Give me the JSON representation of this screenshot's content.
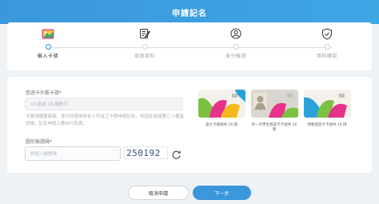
{
  "header": {
    "title": "申請記名"
  },
  "steps": [
    {
      "label": "輸入卡號",
      "icon": "card-icon",
      "active": true
    },
    {
      "label": "填寫資料",
      "icon": "form-edit-icon",
      "active": false
    },
    {
      "label": "身分驗證",
      "icon": "person-verify-icon",
      "active": false
    },
    {
      "label": "資料確認",
      "icon": "shield-check-icon",
      "active": false
    }
  ],
  "form": {
    "card_number": {
      "label": "悠遊卡外觀卡號*",
      "placeholder": "10 碼或 16 碼數字",
      "hint": "卡號須權實填寫，並切勿使用非本人所有之卡號申請記名，如因此造成第三人權益受損，記名申請人應自行負責。"
    },
    "captcha": {
      "label": "圖形驗證碼*",
      "placeholder": "請輸入驗證碼",
      "code": "250192"
    }
  },
  "cards": [
    {
      "caption": "晶片卡號碼共 16 碼"
    },
    {
      "caption": "新一代學生悠遊卡卡號共 16 碼"
    },
    {
      "caption": "特製悠遊卡卡號共 16 碼"
    }
  ],
  "buttons": {
    "cancel": "取消申請",
    "next": "下一步"
  },
  "colors": {
    "primary": "#3a97dc",
    "background": "#eef2f5"
  }
}
